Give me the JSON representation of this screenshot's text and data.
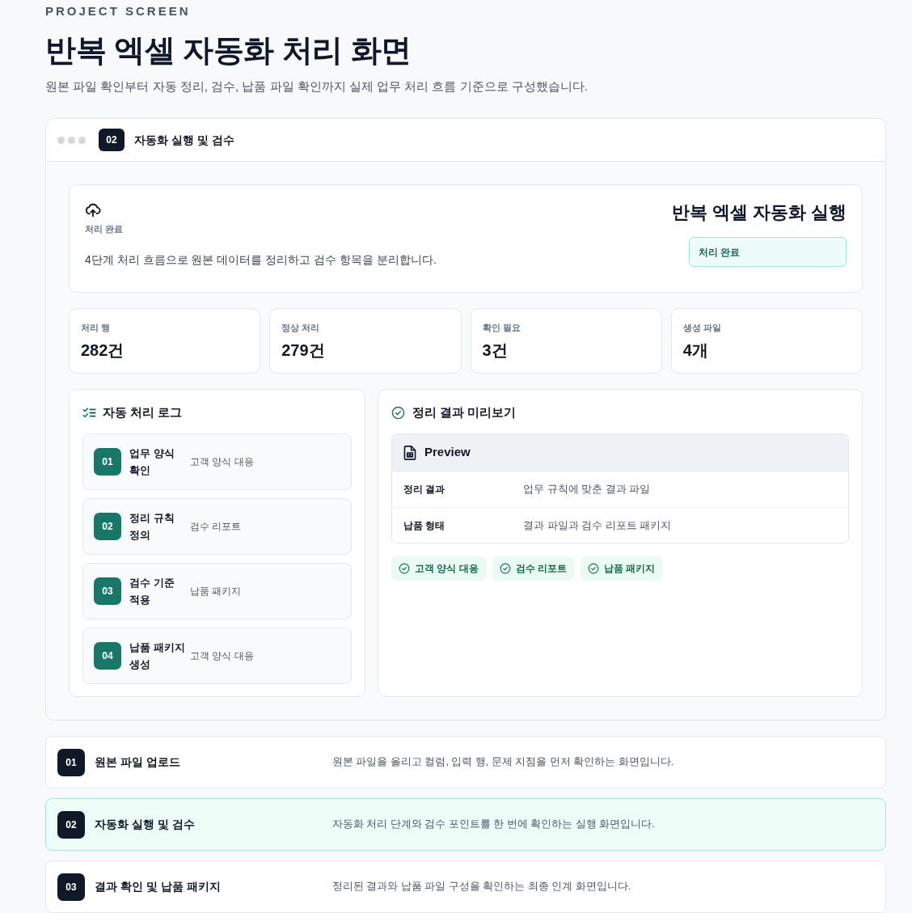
{
  "header": {
    "eyebrow": "PROJECT SCREEN",
    "title": "반복 엑셀 자동화 처리 화면",
    "subtitle": "원본 파일 확인부터 자동 정리, 검수, 납품 파일 확인까지 실제 업무 처리 흐름 기준으로 구성했습니다."
  },
  "panel": {
    "step_number": "02",
    "title": "자동화 실행 및 검수"
  },
  "hero": {
    "label": "처리 완료",
    "description": "4단계 처리 흐름으로 원본 데이터를 정리하고 검수 항목을 분리합니다.",
    "title": "반복 엑셀 자동화 실행",
    "status": "처리 완료"
  },
  "stats": [
    {
      "label": "처리 행",
      "value": "282건"
    },
    {
      "label": "정상 처리",
      "value": "279건"
    },
    {
      "label": "확인 필요",
      "value": "3건"
    },
    {
      "label": "생성 파일",
      "value": "4개"
    }
  ],
  "log": {
    "title": "자동 처리 로그",
    "items": [
      {
        "number": "01",
        "title": "업무 양식 확인",
        "detail": "고객 양식 대응"
      },
      {
        "number": "02",
        "title": "정리 규칙 정의",
        "detail": "검수 리포트"
      },
      {
        "number": "03",
        "title": "검수 기준 적용",
        "detail": "납품 패키지"
      },
      {
        "number": "04",
        "title": "납품 패키지 생성",
        "detail": "고객 양식 대응"
      }
    ]
  },
  "preview": {
    "title": "정리 결과 미리보기",
    "table_title": "Preview",
    "rows": [
      {
        "label": "정리 결과",
        "value": "업무 규칙에 맞춘 결과 파일"
      },
      {
        "label": "납품 형태",
        "value": "결과 파일과 검수 리포트 패키지"
      }
    ],
    "tags": [
      "고객 양식 대응",
      "검수 리포트",
      "납품 패키지"
    ]
  },
  "steps": [
    {
      "number": "01",
      "title": "원본 파일 업로드",
      "description": "원본 파일을 올리고 컬럼, 입력 행, 문제 지점을 먼저 확인하는 화면입니다.",
      "selected": false
    },
    {
      "number": "02",
      "title": "자동화 실행 및 검수",
      "description": "자동화 처리 단계와 검수 포인트를 한 번에 확인하는 실행 화면입니다.",
      "selected": true
    },
    {
      "number": "03",
      "title": "결과 확인 및 납품 패키지",
      "description": "정리된 결과와 납품 파일 구성을 확인하는 최종 인계 화면입니다.",
      "selected": false
    }
  ]
}
